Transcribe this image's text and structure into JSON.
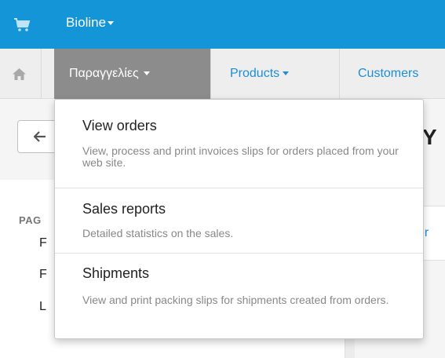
{
  "header": {
    "brand": "Bioline",
    "accent_color": "#1495d8",
    "cart_icon": "shopping-cart-icon"
  },
  "nav": {
    "home_icon": "home-icon",
    "items": [
      {
        "label": "Παραγγελίες",
        "active": true
      },
      {
        "label": "Products"
      },
      {
        "label": "Customers"
      }
    ]
  },
  "dropdown": {
    "items": [
      {
        "title": "View orders",
        "description": "View, process and print invoices slips for orders placed from your web site."
      },
      {
        "title": "Sales reports",
        "description": "Detailed statistics on the sales."
      },
      {
        "title": "Shipments",
        "description": "View and print packing slips for shipments created from orders."
      }
    ]
  },
  "sidebar": {
    "title": "PAG",
    "items": [
      "F",
      "F",
      "L"
    ]
  },
  "page": {
    "heading_fragment": "Y",
    "panel_link_fragment": "er"
  }
}
